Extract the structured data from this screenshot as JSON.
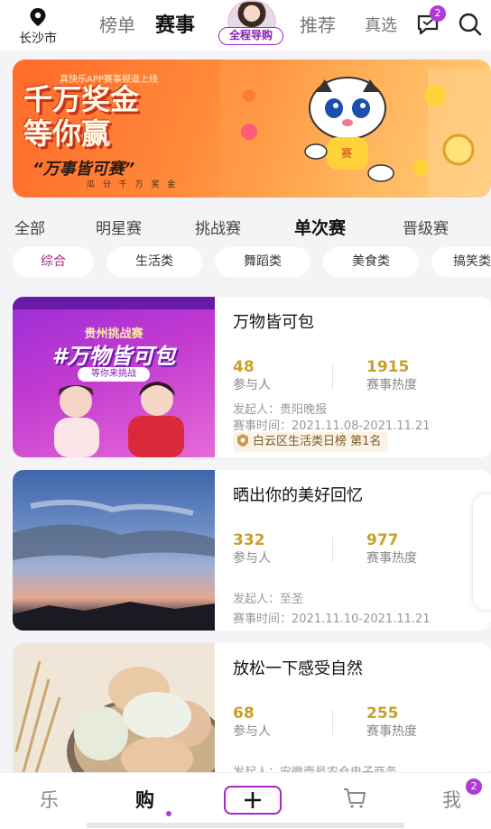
{
  "header": {
    "location": "长沙市",
    "tabs": [
      "榜单",
      "赛事"
    ],
    "avatar_tag": "全程导购",
    "tabs_right": [
      "推荐",
      "真选"
    ],
    "message_badge": "2",
    "accent": "#a626c9"
  },
  "banner": {
    "kicker": "真快乐APP赛事频道上线",
    "title_line1": "千万奖金",
    "title_line2": "等你赢",
    "slogan": "“万事皆可赛”",
    "sub": "瓜 分 千 万 奖 金"
  },
  "categories": [
    "全部",
    "明星赛",
    "挑战赛",
    "单次赛",
    "晋级赛"
  ],
  "tags": [
    "综合",
    "生活类",
    "舞蹈类",
    "美食类",
    "搞笑类"
  ],
  "cards": [
    {
      "title": "万物皆可包",
      "participants": "48",
      "participants_label": "参与人",
      "heat": "1915",
      "heat_label": "赛事热度",
      "organizer": "发起人：贵阳晚报",
      "time": "赛事时间：2021.11.08-2021.11.21",
      "rank": "白云区生活类日榜  第1名",
      "poster_line1": "贵州挑战赛",
      "poster_line2": "#万物皆可包",
      "poster_line3": "等你来挑战"
    },
    {
      "title": "晒出你的美好回忆",
      "participants": "332",
      "participants_label": "参与人",
      "heat": "977",
      "heat_label": "赛事热度",
      "organizer": "发起人：至圣",
      "time": "赛事时间：2021.11.10-2021.11.21"
    },
    {
      "title": "放松一下感受自然",
      "participants": "68",
      "participants_label": "参与人",
      "heat": "255",
      "heat_label": "赛事热度",
      "organizer": "发起人：安徽壹号农仓电子商务"
    }
  ],
  "bottom_nav": {
    "items": [
      "乐",
      "购",
      "我"
    ],
    "plus": "+",
    "me_badge": "2"
  }
}
